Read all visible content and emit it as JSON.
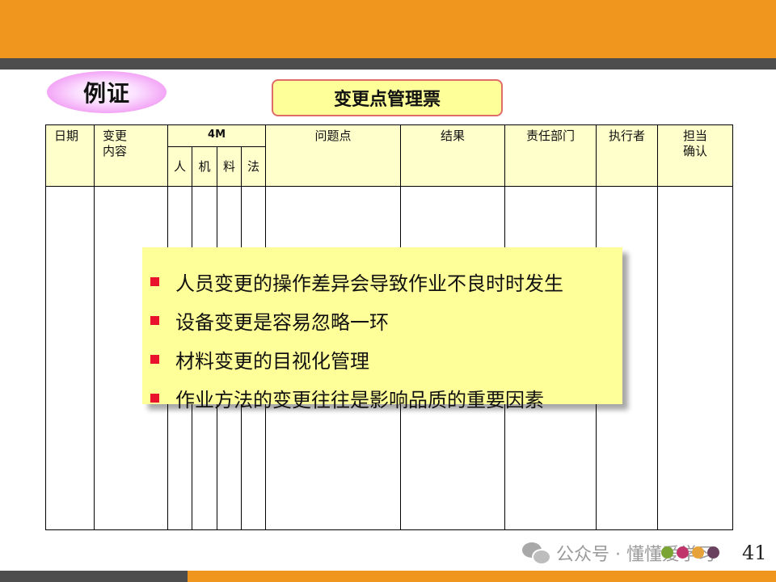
{
  "slide": {
    "badge": "例证",
    "form_title": "变更点管理票",
    "page_number": "41"
  },
  "table": {
    "headers": {
      "date": "日期",
      "change_content": "变更\n内容",
      "m4": "4M",
      "m4_sub": [
        "人",
        "机",
        "料",
        "法"
      ],
      "problem": "问题点",
      "result": "结果",
      "dept": "责任部门",
      "executor": "执行者",
      "confirm": "担当\n确认"
    }
  },
  "callout": {
    "items": [
      "人员变更的操作差异会导致作业不良时时发生",
      "设备变更是容易忽略一环",
      "材料变更的目视化管理",
      "作业方法的变更往往是影响品质的重要因素"
    ]
  },
  "watermark": {
    "text": "公众号 · 懂懂爱学习"
  },
  "colors": {
    "band_orange": "#f0951e",
    "band_gray": "#4d4d4d",
    "header_fill": "#ffffcc",
    "callout_fill": "#ffff99",
    "bullet_red": "#e8122d",
    "dots": [
      "#7aa535",
      "#c0356c",
      "#e8a23a",
      "#6a4260"
    ]
  }
}
